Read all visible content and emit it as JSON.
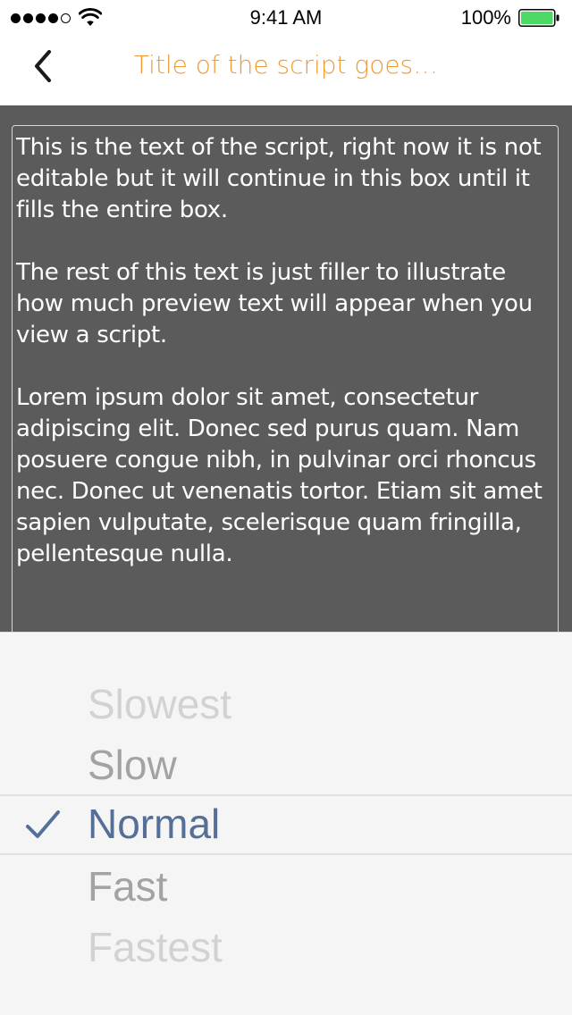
{
  "status_bar": {
    "time": "9:41 AM",
    "battery_percent": "100%",
    "signal_bars_filled": 4,
    "signal_bars_total": 5,
    "battery_level": 1.0,
    "battery_color": "#4cd964"
  },
  "nav": {
    "title": "Title of the script goes…",
    "title_color": "#f29a32"
  },
  "script": {
    "paragraphs": [
      "This is the text of the script, right now it is not editable but it will continue in this box until it fills the entire box.",
      "The rest of this text is just filler to illustrate how much preview text will appear when you view a script.",
      "Lorem ipsum dolor sit amet, consectetur adipiscing elit. Donec sed purus quam. Nam posuere congue nibh, in pulvinar orci rhoncus nec. Donec ut venenatis tortor. Etiam sit amet sapien vulputate, scelerisque quam fringilla, pellentesque nulla."
    ]
  },
  "speed_picker": {
    "options": [
      "Slowest",
      "Slow",
      "Normal",
      "Fast",
      "Fastest"
    ],
    "selected": "Normal",
    "selected_color": "#566f96"
  },
  "icons": {
    "back": "chevron-left-icon",
    "selected_mark": "checkmark-icon",
    "wifi": "wifi-icon",
    "battery": "battery-icon"
  }
}
